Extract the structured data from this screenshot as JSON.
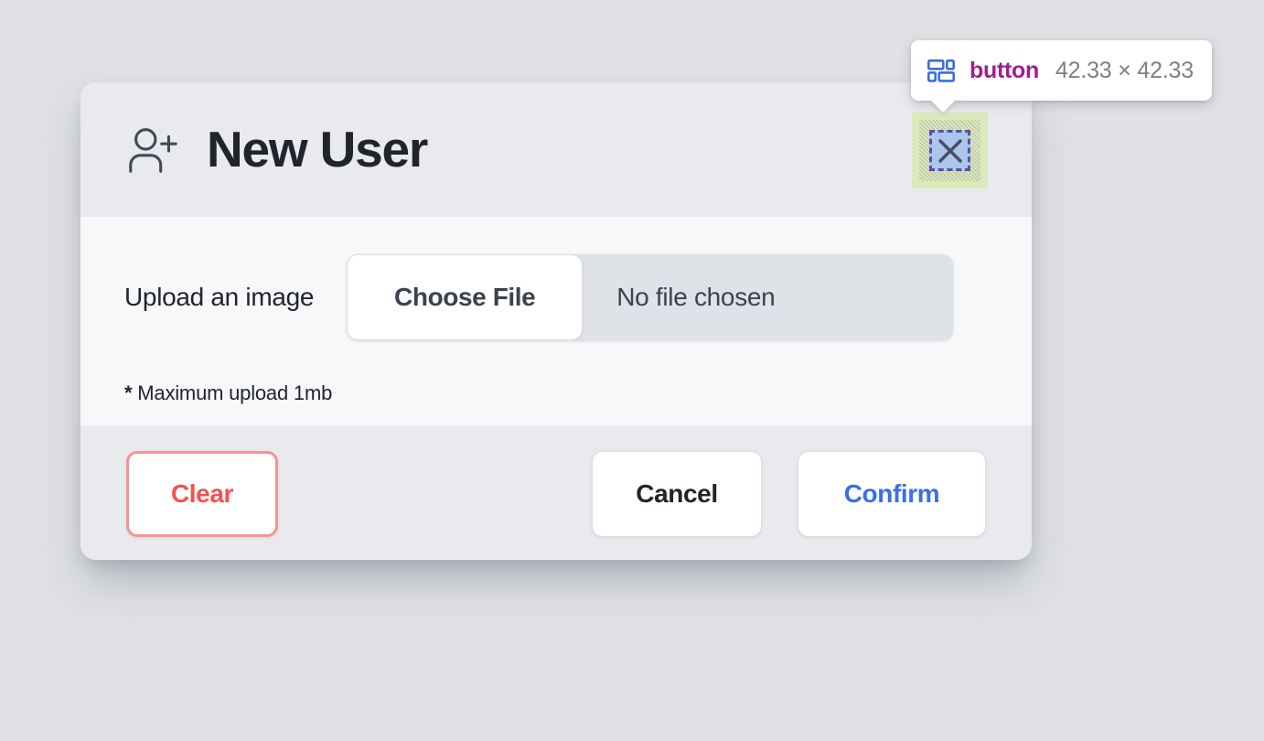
{
  "modal": {
    "title": "New User",
    "title_icon": "user-plus-icon",
    "close_icon": "close-x-icon",
    "body": {
      "upload_label": "Upload an image",
      "choose_file_label": "Choose File",
      "file_name": "No file chosen",
      "hint_asterisk": "*",
      "hint_text": " Maximum upload 1mb"
    },
    "footer": {
      "clear_label": "Clear",
      "cancel_label": "Cancel",
      "confirm_label": "Confirm"
    }
  },
  "inspector": {
    "icon": "layout-grid-icon",
    "tag_name": "button",
    "dimensions": "42.33 × 42.33",
    "highlighted_element": "close-button"
  },
  "colors": {
    "page_background": "#dfe1e4",
    "card_header": "#e9eaee",
    "card_body": "#f7f8fa",
    "card_footer": "#e9eaee",
    "title_text": "#21252b",
    "clear_border": "#f79292",
    "clear_text": "#f4524d",
    "confirm_text": "#3b6ee8",
    "tooltip_tag": "#9c1f8f",
    "tooltip_dims": "#7d7f84",
    "tooltip_icon": "#3b6ee0",
    "highlight_margin": "#dde8bb",
    "highlight_content": "#aac6ee",
    "highlight_border": "#5a4f9e"
  }
}
